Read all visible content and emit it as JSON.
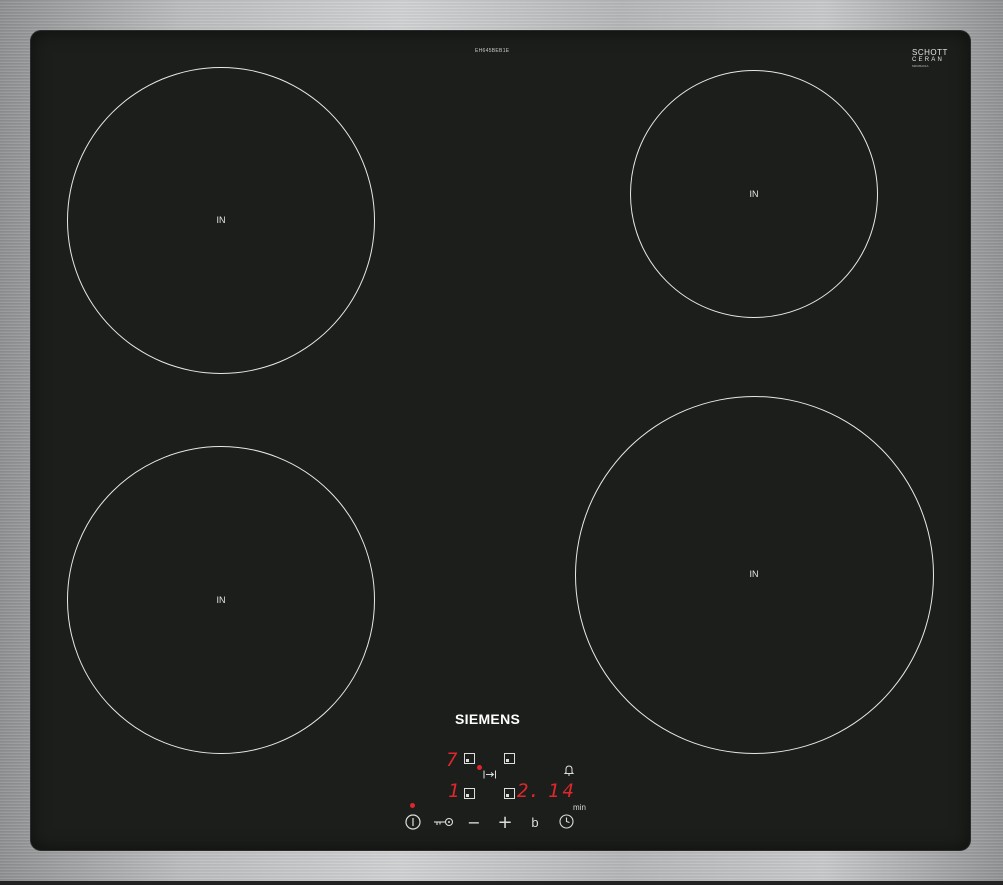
{
  "hob": {
    "model_code": "EH645BEB1E",
    "glass_brand": {
      "line1": "SCHOTT",
      "line2": "CERAN",
      "line3": "M0045A01A"
    },
    "brand": "SIEMENS",
    "zones": [
      {
        "name": "front-left",
        "label": "IN"
      },
      {
        "name": "rear-right",
        "label": "IN"
      },
      {
        "name": "rear-left",
        "label": "IN"
      },
      {
        "name": "front-right",
        "label": "IN"
      }
    ],
    "display": {
      "rear_left_level": "7",
      "front_left_level": "1",
      "front_right_level": "2.",
      "timer_value": "14",
      "timer_unit": "min"
    },
    "controls": {
      "power": "power",
      "lock": "child-lock",
      "minus": "−",
      "plus": "+",
      "boost": "b",
      "timer": "timer"
    },
    "colors": {
      "glass": "#1c1e1b",
      "display_red": "#e0262b",
      "frame": "#b9bbbd"
    }
  }
}
